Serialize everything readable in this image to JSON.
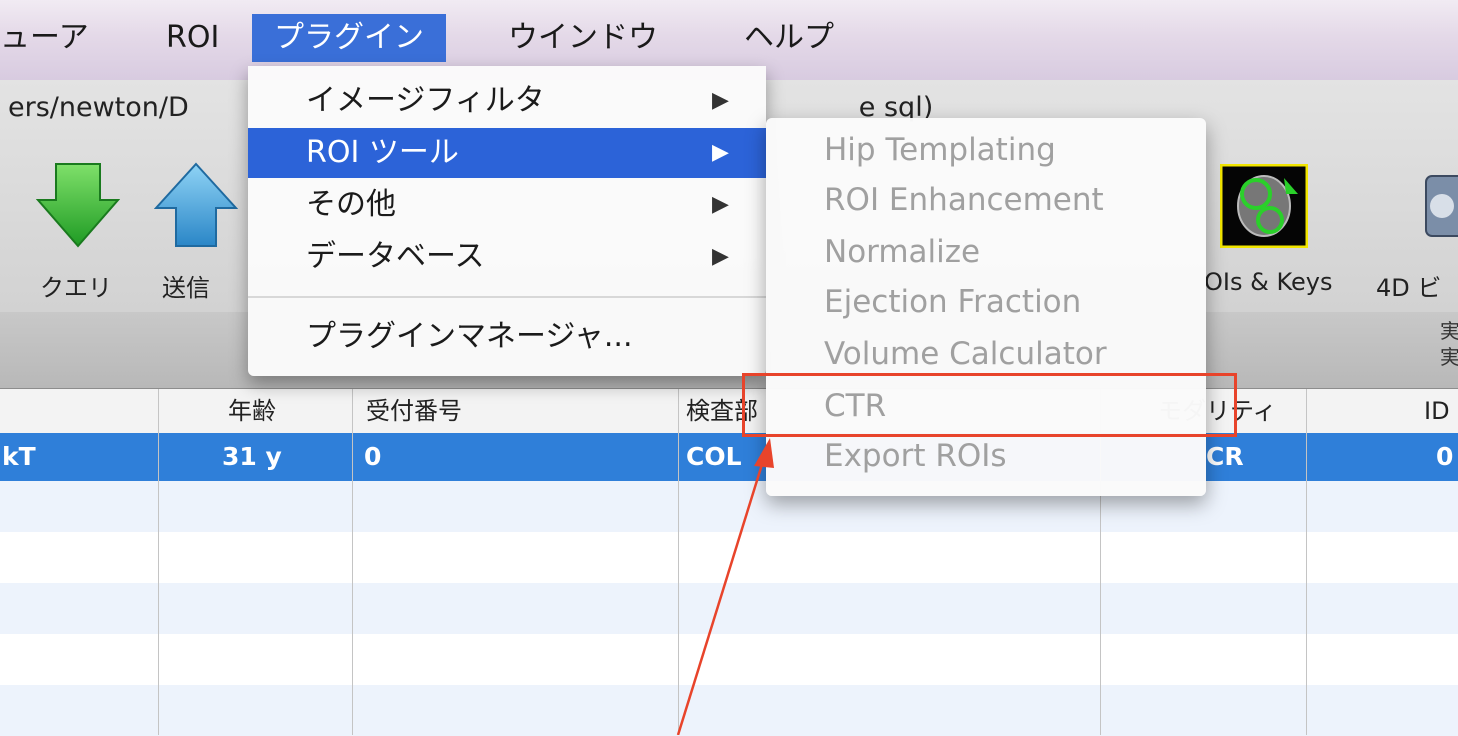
{
  "menubar": {
    "items": [
      "ューア",
      "ROI",
      "プラグイン",
      "ウインドウ",
      "ヘルプ"
    ],
    "active": "プラグイン"
  },
  "window": {
    "path": "ers/newton/D",
    "path_trailing": "e sql)",
    "toolbar": {
      "buttons": [
        {
          "label": "クエリ",
          "icon": "down-arrow-icon"
        },
        {
          "label": "送信",
          "icon": "up-arrow-icon"
        },
        {
          "label": "OIs & Keys",
          "icon": "rois-keys-icon"
        },
        {
          "label": "4D ビ",
          "icon": "4d-viewer-icon"
        }
      ]
    },
    "subbar_right": "実\n実"
  },
  "table": {
    "headers": [
      "年齢",
      "受付番号",
      "検査部",
      "モダリティ",
      "ID"
    ],
    "selected_row": [
      "kT",
      "31 y",
      "0",
      "COL",
      "CR",
      "0"
    ]
  },
  "plugin_menu": {
    "items": [
      {
        "label": "イメージフィルタ",
        "submenu": true
      },
      {
        "label": "ROI ツール",
        "submenu": true,
        "highlighted": true
      },
      {
        "label": "その他",
        "submenu": true
      },
      {
        "label": "データベース",
        "submenu": true
      }
    ],
    "manager": "プラグインマネージャ..."
  },
  "roi_menu": {
    "items": [
      "Hip Templating",
      "ROI Enhancement",
      "Normalize",
      "Ejection Fraction",
      "Volume Calculator",
      "CTR",
      "Export ROIs"
    ],
    "highlighted_item": "CTR"
  },
  "colors": {
    "menu_highlight": "#2c63d8",
    "selected_row": "#2f7fd9",
    "annotation": "#e8442b"
  }
}
